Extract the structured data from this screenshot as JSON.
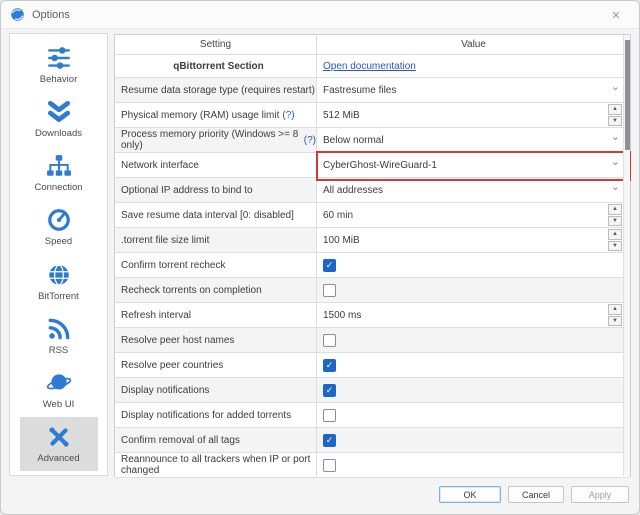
{
  "colors": {
    "accent_blue": "#2e7bd3",
    "link_blue": "#2a56c6",
    "checkbox_blue": "#1e66c5",
    "highlight_red": "#d63a30",
    "selected_item_bg": "#dcdcdc"
  },
  "window": {
    "title": "Options",
    "close_glyph": "✕"
  },
  "sidebar": {
    "items": [
      {
        "id": "behavior",
        "label": "Behavior",
        "icon": "sliders-icon",
        "selected": false
      },
      {
        "id": "downloads",
        "label": "Downloads",
        "icon": "double-chevron-down-icon",
        "selected": false
      },
      {
        "id": "connection",
        "label": "Connection",
        "icon": "network-tree-icon",
        "selected": false
      },
      {
        "id": "speed",
        "label": "Speed",
        "icon": "speedometer-icon",
        "selected": false
      },
      {
        "id": "bittorrent",
        "label": "BitTorrent",
        "icon": "globe-icon",
        "selected": false
      },
      {
        "id": "rss",
        "label": "RSS",
        "icon": "rss-icon",
        "selected": false
      },
      {
        "id": "webui",
        "label": "Web UI",
        "icon": "planet-icon",
        "selected": false
      },
      {
        "id": "advanced",
        "label": "Advanced",
        "icon": "tools-icon",
        "selected": true
      }
    ]
  },
  "table": {
    "header": {
      "setting": "Setting",
      "value": "Value"
    },
    "section": {
      "title": "qBittorrent Section",
      "link": "Open documentation"
    },
    "rows": [
      {
        "setting": "Resume data storage type (requires restart)",
        "control": "select",
        "value": "Fastresume files"
      },
      {
        "setting": "Physical memory (RAM) usage limit",
        "help": "(?)",
        "control": "spin",
        "value": "512 MiB"
      },
      {
        "setting": "Process memory priority (Windows >= 8 only)",
        "help": "(?)",
        "control": "select",
        "value": "Below normal"
      },
      {
        "setting": "Network interface",
        "control": "select",
        "value": "CyberGhost-WireGuard-1",
        "highlighted": true
      },
      {
        "setting": "Optional IP address to bind to",
        "control": "select",
        "value": "All addresses"
      },
      {
        "setting": "Save resume data interval [0: disabled]",
        "control": "spin",
        "value": "60 min"
      },
      {
        "setting": ".torrent file size limit",
        "control": "spin",
        "value": "100 MiB"
      },
      {
        "setting": "Confirm torrent recheck",
        "control": "checkbox",
        "checked": true
      },
      {
        "setting": "Recheck torrents on completion",
        "control": "checkbox",
        "checked": false
      },
      {
        "setting": "Refresh interval",
        "control": "spin",
        "value": "1500 ms"
      },
      {
        "setting": "Resolve peer host names",
        "control": "checkbox",
        "checked": false
      },
      {
        "setting": "Resolve peer countries",
        "control": "checkbox",
        "checked": true
      },
      {
        "setting": "Display notifications",
        "control": "checkbox",
        "checked": true
      },
      {
        "setting": "Display notifications for added torrents",
        "control": "checkbox",
        "checked": false
      },
      {
        "setting": "Confirm removal of all tags",
        "control": "checkbox",
        "checked": true
      },
      {
        "setting": "Reannounce to all trackers when IP or port changed",
        "control": "checkbox",
        "checked": false
      }
    ]
  },
  "footer": {
    "ok": "OK",
    "cancel": "Cancel",
    "apply": "Apply"
  },
  "glyphs": {
    "chevron_down": "⌄",
    "spin_up": "▲",
    "spin_down": "▼",
    "check": "✓"
  }
}
